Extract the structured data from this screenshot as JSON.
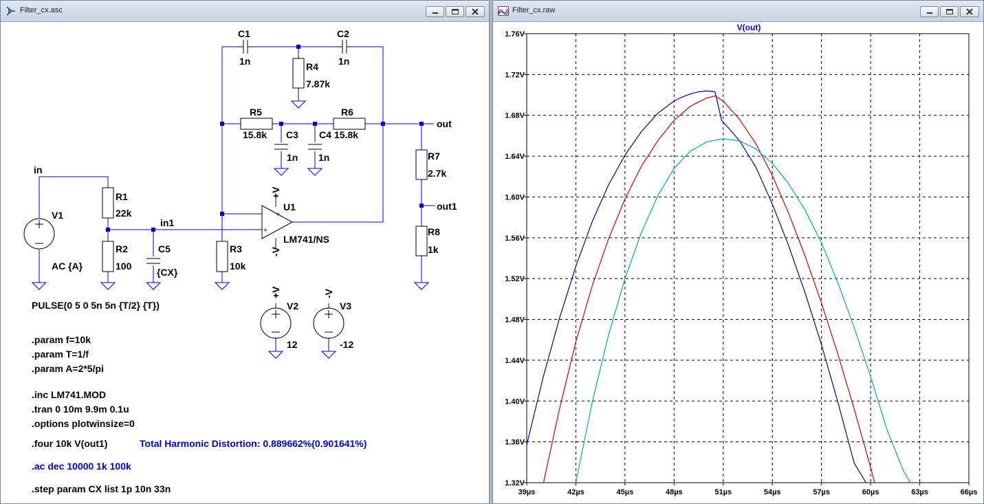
{
  "left_window": {
    "title": "Filter_cx.asc",
    "components": {
      "C1": {
        "name": "C1",
        "value": "1n"
      },
      "C2": {
        "name": "C2",
        "value": "1n"
      },
      "R4": {
        "name": "R4",
        "value": "7.87k"
      },
      "R5": {
        "name": "R5",
        "value": "15.8k"
      },
      "R6": {
        "name": "R6",
        "value": "15.8k"
      },
      "C3": {
        "name": "C3",
        "value": "1n"
      },
      "C4": {
        "name": "C4",
        "value": "1n"
      },
      "R7": {
        "name": "R7",
        "value": "2.7k"
      },
      "R8": {
        "name": "R8",
        "value": "1k"
      },
      "R1": {
        "name": "R1",
        "value": "22k"
      },
      "R2": {
        "name": "R2",
        "value": "100"
      },
      "C5": {
        "name": "C5",
        "value": "{CX}"
      },
      "R3": {
        "name": "R3",
        "value": "10k"
      },
      "V1": {
        "name": "V1",
        "value": "AC {A}"
      },
      "V2": {
        "name": "V2",
        "value": "12"
      },
      "V3": {
        "name": "V3",
        "value": "-12"
      },
      "U1": {
        "name": "U1",
        "value": "LM741/NS"
      }
    },
    "net_labels": {
      "in": "in",
      "in1": "in1",
      "out": "out",
      "out1": "out1",
      "plus_v": "+V",
      "minus_v": "-V"
    },
    "opamp_pins": {
      "plus": "+",
      "minus": "-"
    },
    "directives": {
      "pulse": "PULSE(0 5 0 5n 5n {T/2} {T})",
      "param_f": ".param f=10k",
      "param_T": ".param T=1/f",
      "param_A": ".param A=2*5/pi",
      "inc": ".inc LM741.MOD",
      "tran": ".tran 0 10m 9.9m 0.1u",
      "options": ".options plotwinsize=0",
      "four": ".four 10k V(out1)",
      "thd": "Total Harmonic Distortion: 0.889662%(0.901641%)",
      "ac": ".ac dec 10000 1k 100k",
      "step": ".step param CX list 1p 10n 33n"
    },
    "colors": {
      "wire": "#0000cc",
      "text": "#000000",
      "directive_blue": "#0000cc"
    }
  },
  "right_window": {
    "title": "Filter_cx.raw",
    "chart_data": {
      "type": "line",
      "title": "V(out)",
      "xlabel": "",
      "ylabel": "",
      "xlim": [
        39,
        66
      ],
      "ylim": [
        1.32,
        1.76
      ],
      "x_ticks": [
        "39µs",
        "42µs",
        "45µs",
        "48µs",
        "51µs",
        "54µs",
        "57µs",
        "60µs",
        "63µs",
        "66µs"
      ],
      "y_ticks": [
        "1.76V",
        "1.72V",
        "1.68V",
        "1.64V",
        "1.60V",
        "1.56V",
        "1.52V",
        "1.48V",
        "1.44V",
        "1.40V",
        "1.36V",
        "1.32V"
      ],
      "grid": true,
      "series": [
        {
          "color": "#0000a8",
          "x": [
            39,
            40,
            41,
            42,
            43,
            44,
            45,
            46,
            47,
            48,
            48.5,
            49,
            49.5,
            50,
            50.5,
            50.9,
            51.3,
            52,
            53,
            54,
            55,
            56,
            57,
            58,
            59,
            59.8
          ],
          "y": [
            1.357,
            1.423,
            1.481,
            1.532,
            1.576,
            1.612,
            1.641,
            1.664,
            1.682,
            1.694,
            1.698,
            1.701,
            1.703,
            1.704,
            1.703,
            1.675,
            1.668,
            1.655,
            1.629,
            1.593,
            1.552,
            1.506,
            1.455,
            1.399,
            1.339,
            1.318
          ]
        },
        {
          "color": "#cc0000",
          "x": [
            40,
            41,
            42,
            43,
            44,
            45,
            46,
            47,
            48,
            49,
            50,
            50.5,
            51,
            52,
            53,
            54,
            55,
            56,
            57,
            58,
            59,
            60,
            60.5,
            61
          ],
          "y": [
            1.318,
            1.392,
            1.458,
            1.513,
            1.559,
            1.598,
            1.63,
            1.655,
            1.675,
            1.689,
            1.697,
            1.699,
            1.694,
            1.676,
            1.652,
            1.621,
            1.584,
            1.542,
            1.496,
            1.446,
            1.392,
            1.335,
            1.305,
            1.275
          ]
        },
        {
          "color": "#00a8b4",
          "x": [
            42,
            43,
            44,
            45,
            46,
            47,
            48,
            49,
            50,
            51,
            52,
            53,
            54,
            55,
            56,
            57,
            58,
            59,
            60,
            61,
            62,
            62.5
          ],
          "y": [
            1.32,
            1.399,
            1.465,
            1.52,
            1.565,
            1.601,
            1.628,
            1.645,
            1.654,
            1.657,
            1.655,
            1.647,
            1.633,
            1.613,
            1.587,
            1.555,
            1.516,
            1.472,
            1.424,
            1.372,
            1.332,
            1.318
          ]
        }
      ]
    }
  }
}
